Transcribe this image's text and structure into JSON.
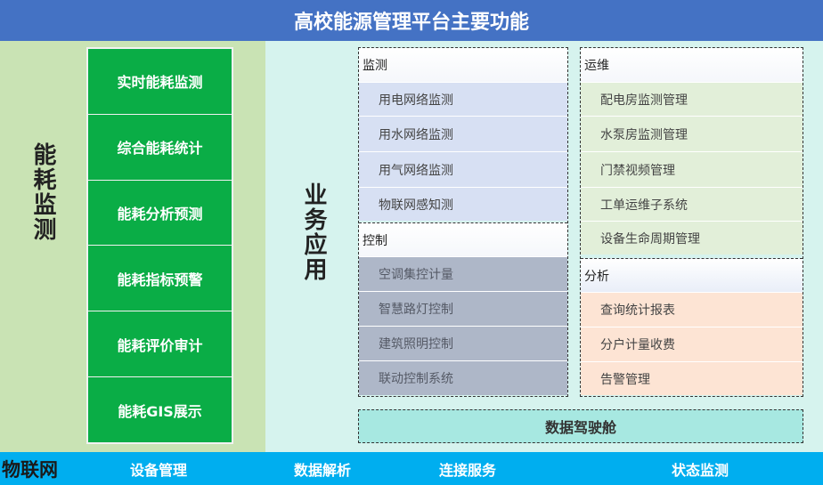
{
  "title": "高校能源管理平台主要功能",
  "left": {
    "title": "能耗监测",
    "items": [
      "实时能耗监测",
      "综合能耗统计",
      "能耗分析预测",
      "能耗指标预警",
      "能耗评价审计",
      "能耗GIS展示"
    ]
  },
  "right": {
    "title": "业务应用",
    "monitor": {
      "header": "监测",
      "items": [
        "用电网络监测",
        "用水网络监测",
        "用气网络监测",
        "物联网感知测"
      ]
    },
    "control": {
      "header": "控制",
      "items": [
        "空调集控计量",
        "智慧路灯控制",
        "建筑照明控制",
        "联动控制系统"
      ]
    },
    "ops": {
      "header": "运维",
      "items": [
        "配电房监测管理",
        "水泵房监测管理",
        "门禁视频管理",
        "工单运维子系统",
        "设备生命周期管理"
      ]
    },
    "analysis": {
      "header": "分析",
      "items": [
        "查询统计报表",
        "分户计量收费",
        "告警管理"
      ]
    },
    "cockpit": "数据驾驶舱"
  },
  "bottom": {
    "label": "物联网",
    "items": [
      "设备管理",
      "数据解析",
      "连接服务",
      "状态监测"
    ]
  },
  "colors": {
    "title_bar": "#4472c4",
    "left_bg": "#c9e3b4",
    "green_col": "#0aad46",
    "right_bg": "#d6f3ee",
    "monitor_items": "#d7e0f3",
    "control_items": "#aeb7c8",
    "ops_items": "#e2efd9",
    "analysis_items": "#fde4d4",
    "cockpit": "#a7e8e1",
    "bottom_bar": "#00aeef"
  }
}
